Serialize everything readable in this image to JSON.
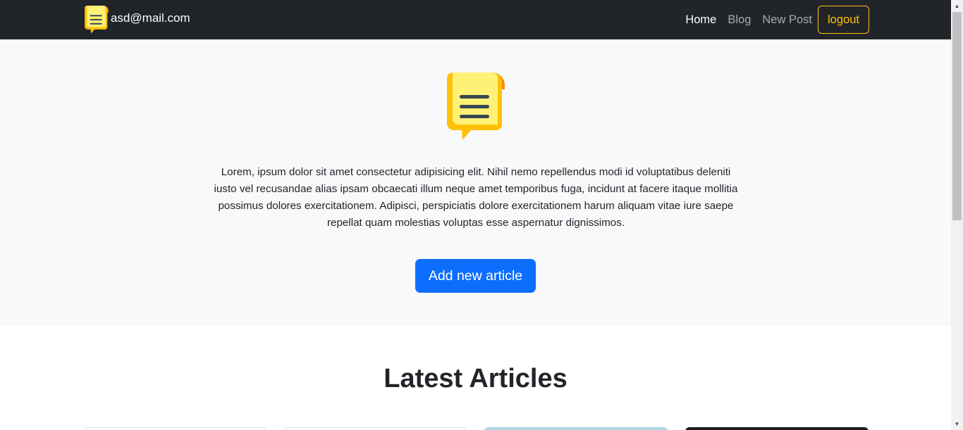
{
  "navbar": {
    "brand_text": "asd@mail.com",
    "links": [
      {
        "label": "Home",
        "active": true
      },
      {
        "label": "Blog",
        "active": false
      },
      {
        "label": "New Post",
        "active": false
      }
    ],
    "logout_label": "logout"
  },
  "hero": {
    "logo_icon": "notepad-chat-icon",
    "paragraph": "Lorem, ipsum dolor sit amet consectetur adipisicing elit. Nihil nemo repellendus modi id voluptatibus deleniti iusto vel recusandae alias ipsam obcaecati illum neque amet temporibus fuga, incidunt at facere itaque mollitia possimus dolores exercitationem. Adipisci, perspiciatis dolore exercitationem harum aliquam vitae iure saepe repellat quam molestias voluptas esse aspernatur dignissimos.",
    "add_button_label": "Add new article"
  },
  "articles": {
    "title": "Latest Articles"
  },
  "colors": {
    "navbar_bg": "#212529",
    "accent_warning": "#ffc107",
    "primary": "#0d6efd",
    "hero_bg": "#f8f9fa"
  },
  "scrollbar": {
    "up_icon": "scroll-up-arrow-icon",
    "down_icon": "scroll-down-arrow-icon"
  }
}
